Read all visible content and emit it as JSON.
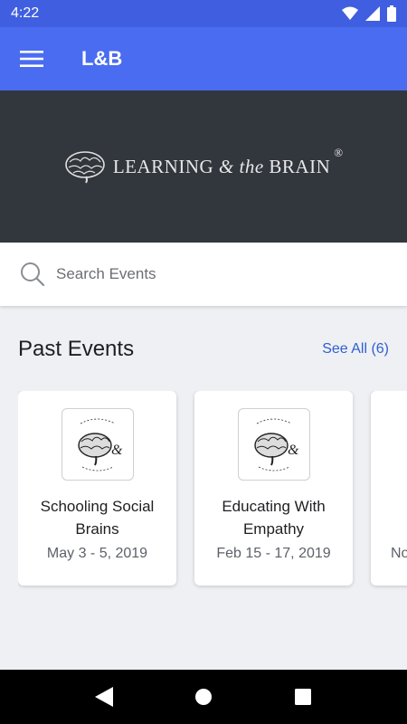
{
  "status_bar": {
    "time": "4:22",
    "icons": [
      "wifi-icon",
      "signal-icon",
      "battery-icon"
    ]
  },
  "app_bar": {
    "title": "L&B",
    "menu_icon": "hamburger-menu-icon"
  },
  "banner": {
    "logo_text_1": "LEARNING",
    "logo_text_amp": " & the ",
    "logo_text_2": "BRAIN",
    "logo_reg": "®"
  },
  "search": {
    "placeholder": "Search Events",
    "value": ""
  },
  "past_events": {
    "title": "Past Events",
    "see_all": "See All (6)",
    "events": [
      {
        "title": "Schooling Social Brains",
        "date": "May 3 - 5, 2019"
      },
      {
        "title": "Educating With Empathy",
        "date": "Feb 15 - 17, 2019"
      },
      {
        "title": "",
        "date": "No"
      }
    ]
  },
  "colors": {
    "app_bar": "#4a6cf0",
    "status_bar": "#3f5fe0",
    "banner": "#32363d",
    "link": "#2f5fd0"
  }
}
